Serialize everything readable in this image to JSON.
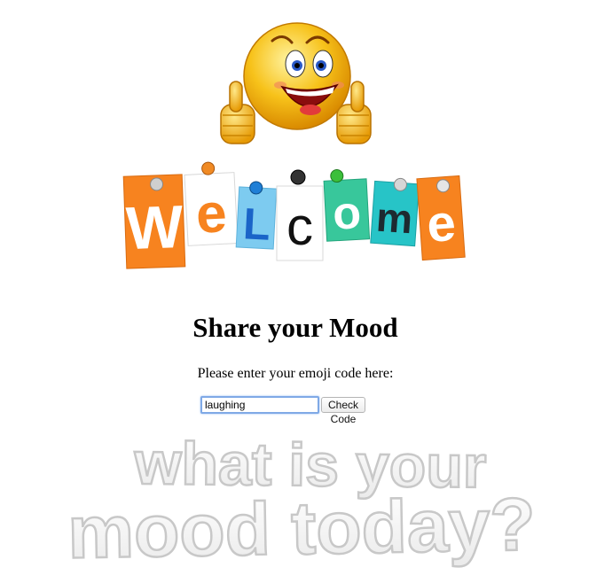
{
  "hero": {
    "welcome_letters": [
      "W",
      "e",
      "L",
      "c",
      "o",
      "m",
      "e"
    ],
    "letter_colors": [
      "#f7831f",
      "#ffffff",
      "#6ec6f0",
      "#ffffff",
      "#2fbf95",
      "#1cc2c4",
      "#f7831f"
    ],
    "emoji": "smiley-thumbs-up"
  },
  "main": {
    "title": "Share your Mood",
    "prompt": "Please enter your emoji code here:"
  },
  "form": {
    "input_value": "laughing",
    "button_label": "Check Code"
  },
  "banner": {
    "line1": "what is your",
    "line2": "mood today?"
  },
  "colors": {
    "input_focus": "#7fa9e6",
    "emoji_yellow": "#f7c21a"
  }
}
